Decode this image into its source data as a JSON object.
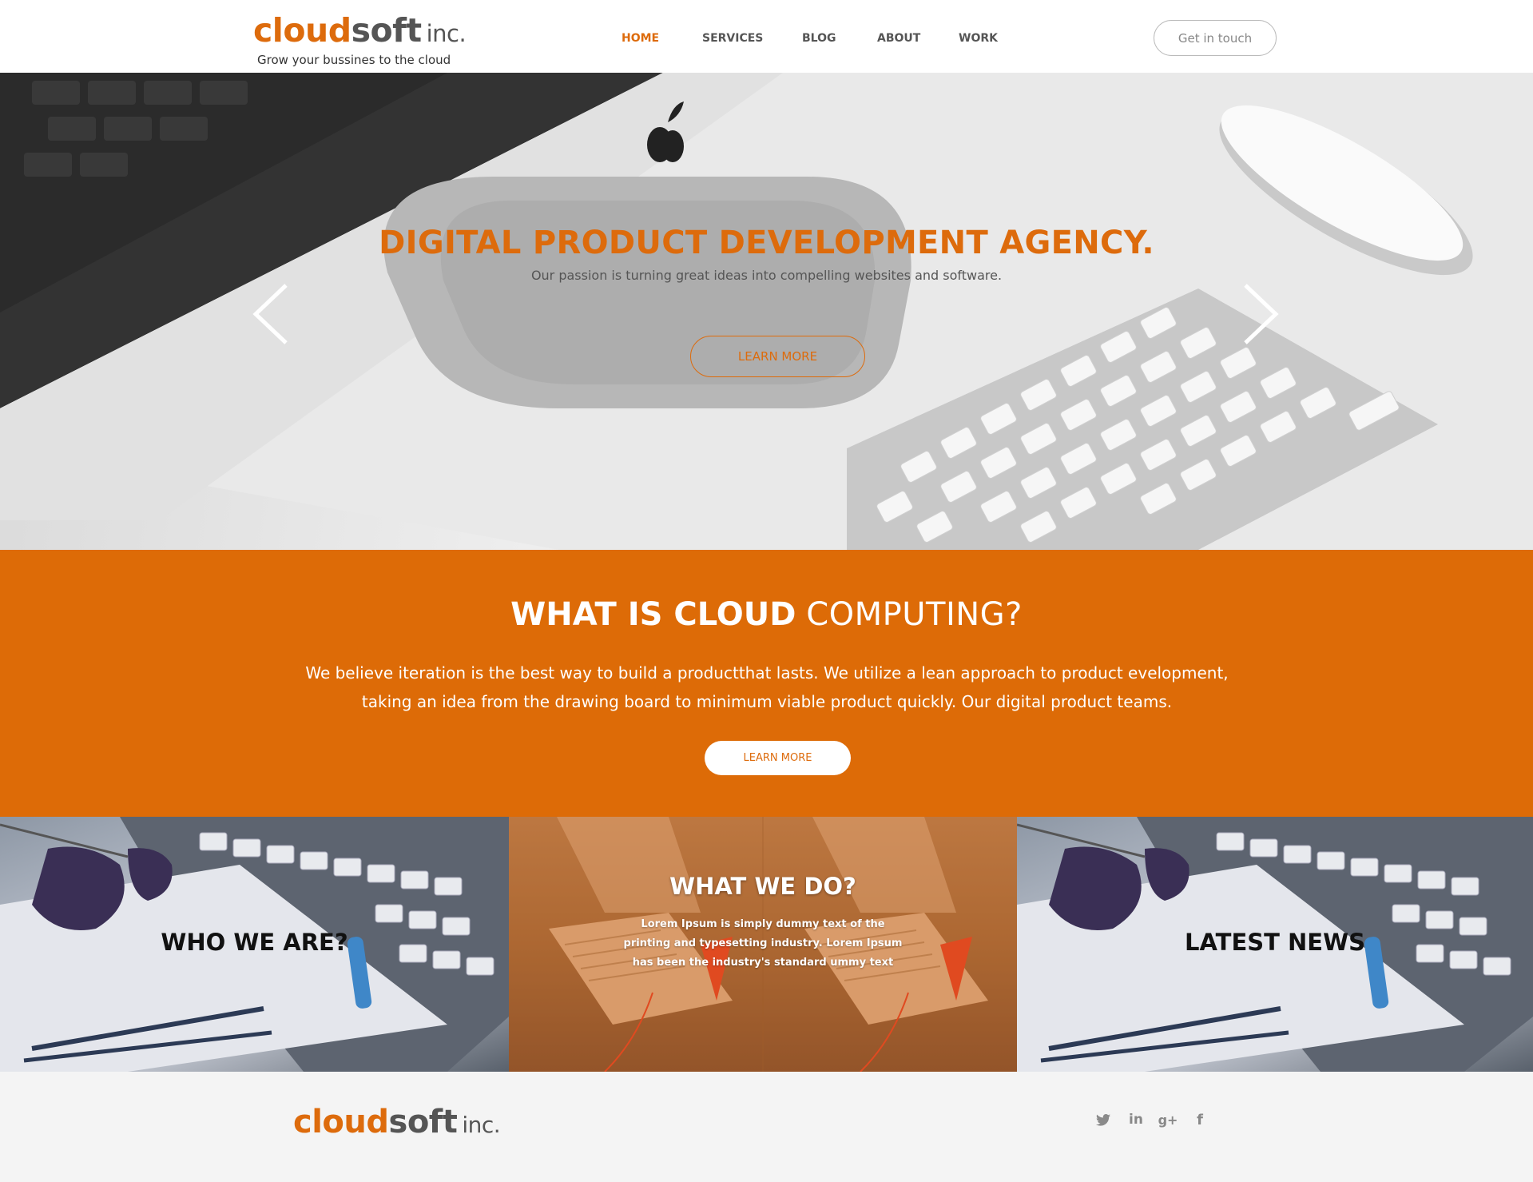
{
  "brand": {
    "name_part1": "cloud",
    "name_part2": "soft",
    "name_suffix": "inc.",
    "tagline": "Grow your bussines to the cloud"
  },
  "nav": {
    "items": [
      {
        "label": "HOME",
        "active": true
      },
      {
        "label": "SERVICES",
        "active": false
      },
      {
        "label": "BLOG",
        "active": false
      },
      {
        "label": "ABOUT",
        "active": false
      },
      {
        "label": "WORK",
        "active": false
      }
    ],
    "cta": "Get in touch"
  },
  "hero": {
    "title": "DIGITAL PRODUCT DEVELOPMENT AGENCY.",
    "subtitle": "Our passion is turning great ideas into compelling websites and software.",
    "button": "LEARN MORE",
    "prev_icon": "chevron-left-icon",
    "next_icon": "chevron-right-icon"
  },
  "intro": {
    "title_bold": "WHAT IS CLOUD",
    "title_light": "COMPUTING?",
    "text": "We believe iteration is the best way to build a productthat lasts. We utilize a lean approach to product evelopment, taking an idea from the drawing board to minimum viable product quickly. Our digital product teams.",
    "button": "LEARN MORE"
  },
  "panels": [
    {
      "title": "WHO WE ARE?"
    },
    {
      "title": "WHAT WE DO?",
      "text": "Lorem Ipsum is simply dummy text of the printing and typesetting industry. Lorem Ipsum has been the industry's standard ummy text"
    },
    {
      "title": "LATEST NEWS"
    }
  ],
  "footer": {
    "social": [
      {
        "icon": "twitter-icon",
        "glyph": "🐦"
      },
      {
        "icon": "linkedin-icon",
        "glyph": "in"
      },
      {
        "icon": "google-plus-icon",
        "glyph": "g+"
      },
      {
        "icon": "facebook-icon",
        "glyph": "f"
      }
    ]
  },
  "colors": {
    "accent": "#dd6b07",
    "text_dark": "#555555",
    "footer_bg": "#f4f4f4"
  }
}
